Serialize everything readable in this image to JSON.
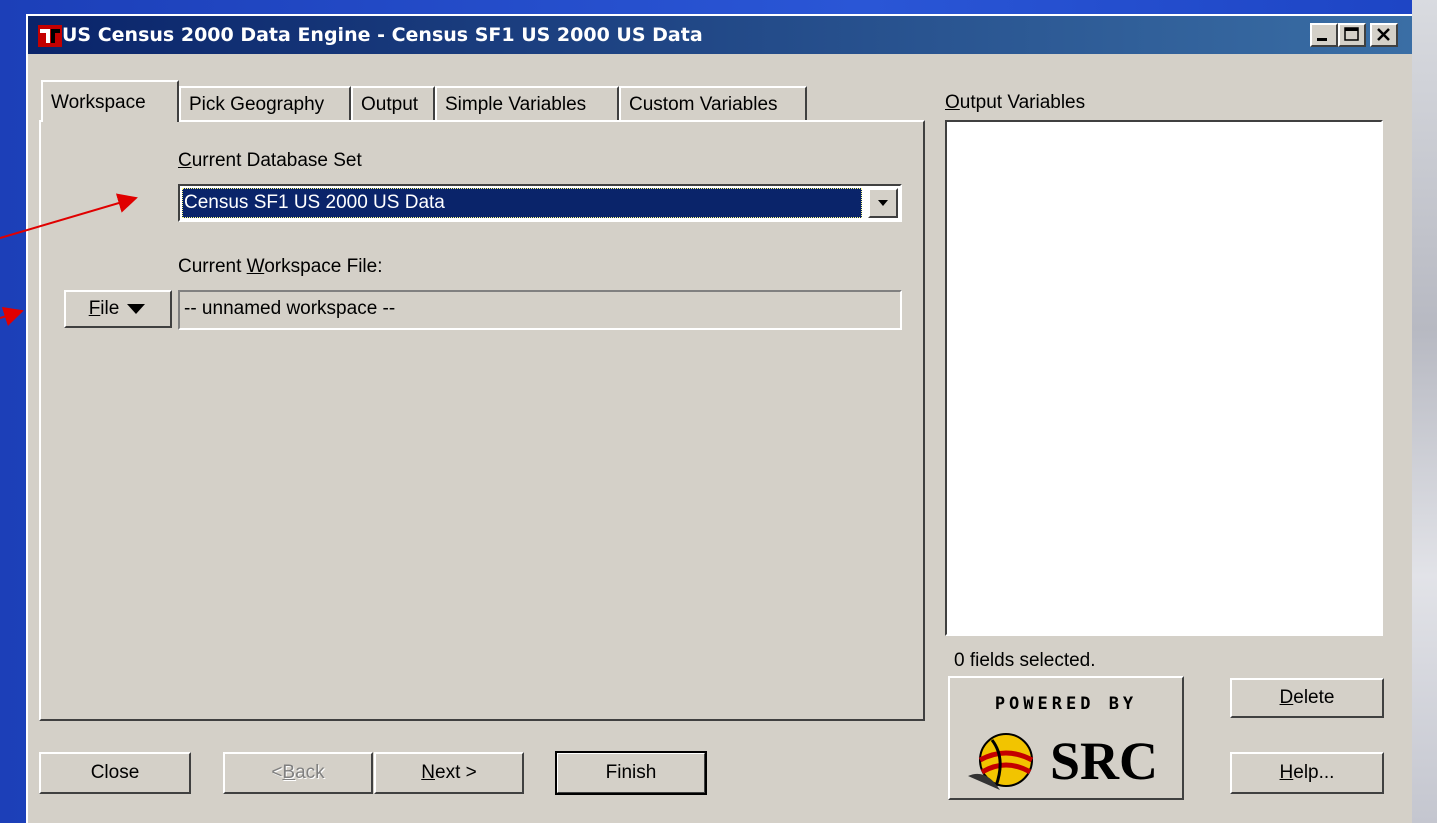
{
  "window": {
    "title": "US Census 2000 Data Engine - Census SF1 US 2000 US Data",
    "controls": [
      "minimize",
      "maximize",
      "close"
    ]
  },
  "tabs": [
    {
      "label": "Workspace",
      "active": true
    },
    {
      "label": "Pick Geography",
      "active": false
    },
    {
      "label": "Output",
      "active": false
    },
    {
      "label": "Simple Variables",
      "active": false
    },
    {
      "label": "Custom Variables",
      "active": false
    }
  ],
  "workspace": {
    "database_label_pre": "",
    "database_label_key": "C",
    "database_label_post": "urrent Database Set",
    "database_value": "Census SF1 US 2000 US Data",
    "workspace_label_pre": "Current ",
    "workspace_label_key": "W",
    "workspace_label_post": "orkspace File:",
    "file_button_key": "F",
    "file_button_post": "ile",
    "workspace_value": "-- unnamed workspace --"
  },
  "output": {
    "label_key": "O",
    "label_post": "utput Variables",
    "status": "0 fields selected."
  },
  "buttons": {
    "delete_key": "D",
    "delete_post": "elete",
    "help_key": "H",
    "help_post": "elp...",
    "close": "Close",
    "back_pre": "< ",
    "back_key": "B",
    "back_post": "ack",
    "next_key": "N",
    "next_post": "ext >",
    "finish": "Finish"
  },
  "logo": {
    "powered_by": "POWERED BY",
    "brand": "SRC"
  },
  "colors": {
    "title_bar": "#0a246a",
    "window_face": "#d4d0c8",
    "selection": "#0a246a",
    "annotation_arrow": "#e00000"
  }
}
